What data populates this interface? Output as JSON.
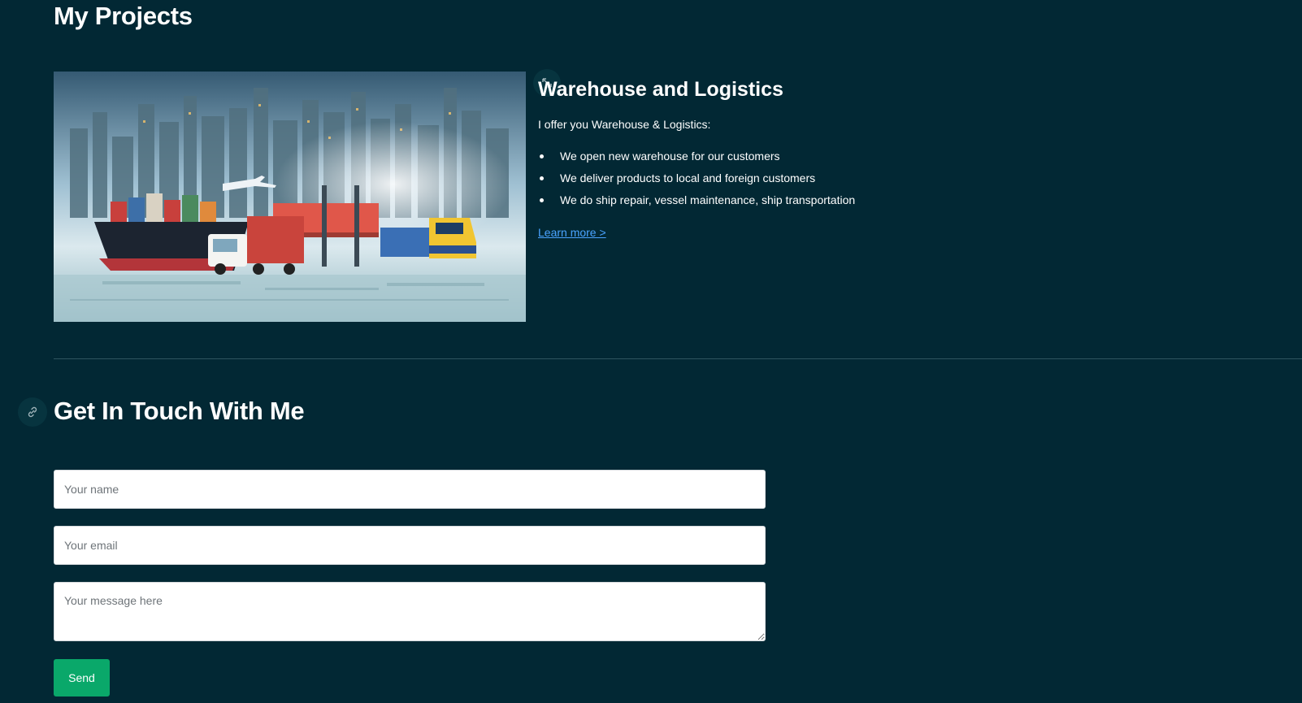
{
  "projects": {
    "title": "My Projects",
    "items": [
      {
        "title": "Warehouse and Logistics",
        "intro": "I offer you Warehouse & Logistics:",
        "bullets": [
          "We open new warehouse for our customers",
          "We deliver products to local and foreign customers",
          "We do ship repair, vessel maintenance, ship transportation"
        ],
        "link_label": "Learn more >",
        "image_alt": "Cargo ship, truck, train and airplane in front of a city skyline"
      }
    ],
    "expand_icon": "expand-icon"
  },
  "contact": {
    "title": "Get In Touch With Me",
    "anchor_icon": "link-icon",
    "name_placeholder": "Your name",
    "email_placeholder": "Your email",
    "message_placeholder": "Your message here",
    "send_label": "Send"
  },
  "colors": {
    "background": "#022834",
    "send_button": "#0aa86a",
    "link": "#4aa3ff"
  }
}
